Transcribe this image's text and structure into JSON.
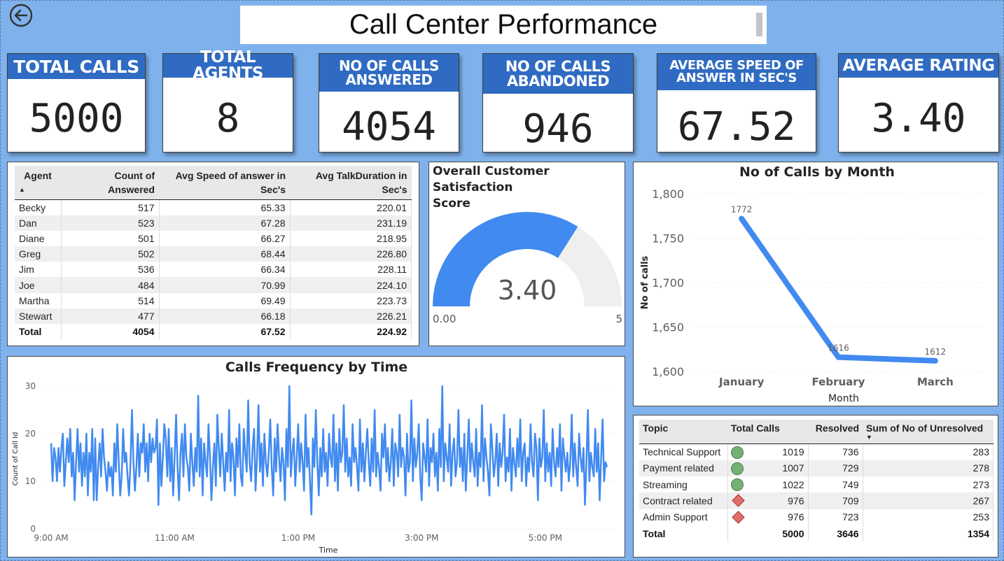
{
  "header": {
    "title": "Call Center Performance"
  },
  "kpis": {
    "total_calls": {
      "label": "TOTAL CALLS",
      "value": "5000"
    },
    "total_agents": {
      "label": "TOTAL AGENTS",
      "value": "8"
    },
    "answered": {
      "label_1": "NO OF CALLS",
      "label_2": "ANSWERED",
      "value": "4054"
    },
    "abandoned": {
      "label_1": "NO OF CALLS",
      "label_2": "ABANDONED",
      "value": "946"
    },
    "speed": {
      "label_1": "AVERAGE SPEED OF",
      "label_2": "ANSWER IN SEC'S",
      "value": "67.52"
    },
    "rating": {
      "label": "AVERAGE RATING",
      "value": "3.40"
    }
  },
  "agent_table": {
    "headers": {
      "agent": "Agent",
      "count_1": "Count of",
      "count_2": "Answered",
      "speed_1": "Avg Speed of answer in",
      "speed_2": "Sec's",
      "talk_1": "Avg TalkDuration in",
      "talk_2": "Sec's"
    },
    "rows": [
      {
        "agent": "Becky",
        "count": "517",
        "speed": "65.33",
        "talk": "220.01"
      },
      {
        "agent": "Dan",
        "count": "523",
        "speed": "67.28",
        "talk": "231.19"
      },
      {
        "agent": "Diane",
        "count": "501",
        "speed": "66.27",
        "talk": "218.95"
      },
      {
        "agent": "Greg",
        "count": "502",
        "speed": "68.44",
        "talk": "226.80"
      },
      {
        "agent": "Jim",
        "count": "536",
        "speed": "66.34",
        "talk": "228.11"
      },
      {
        "agent": "Joe",
        "count": "484",
        "speed": "70.99",
        "talk": "224.10"
      },
      {
        "agent": "Martha",
        "count": "514",
        "speed": "69.49",
        "talk": "223.73"
      },
      {
        "agent": "Stewart",
        "count": "477",
        "speed": "66.18",
        "talk": "226.21"
      }
    ],
    "total": {
      "label": "Total",
      "count": "4054",
      "speed": "67.52",
      "talk": "224.92"
    }
  },
  "gauge": {
    "title_1": "Overall Customer Satisfaction",
    "title_2": "Score",
    "value": 3.4,
    "value_label": "3.40",
    "min": 0,
    "max": 5,
    "min_label": "0.00",
    "max_label": "5",
    "fill_color": "#418af0",
    "track_color": "#efefef"
  },
  "chart_data": [
    {
      "type": "line",
      "title": "No of Calls by Month",
      "xlabel": "Month",
      "ylabel": "No of calls",
      "categories": [
        "January",
        "February",
        "March"
      ],
      "values": [
        1772,
        1616,
        1612
      ],
      "data_labels": [
        "1772",
        "1616",
        "1612"
      ],
      "ylim": [
        1600,
        1800
      ],
      "yticks": [
        1600,
        1650,
        1700,
        1750,
        1800
      ],
      "ytick_labels": [
        "1,600",
        "1,650",
        "1,700",
        "1,750",
        "1,800"
      ],
      "color": "#418af0",
      "grid": true
    },
    {
      "type": "line",
      "title": "Calls Frequency by Time",
      "xlabel": "Time",
      "ylabel": "Count of Call Id",
      "xticks": [
        "9:00 AM",
        "11:00 AM",
        "1:00 PM",
        "3:00 PM",
        "5:00 PM"
      ],
      "xrange_minutes": [
        540,
        1080
      ],
      "yticks": [
        0,
        10,
        20,
        30
      ],
      "ylim": [
        0,
        30
      ],
      "color": "#418af0",
      "grid": true,
      "values": [
        18,
        10,
        17,
        15,
        10,
        17,
        12,
        17,
        20,
        9,
        14,
        19,
        14,
        21,
        11,
        16,
        6,
        14,
        21,
        12,
        18,
        9,
        16,
        11,
        20,
        7,
        16,
        12,
        21,
        6,
        19,
        6,
        13,
        18,
        11,
        21,
        15,
        12,
        8,
        14,
        11,
        13,
        7,
        18,
        12,
        22,
        14,
        7,
        11,
        21,
        14,
        16,
        11,
        7,
        14,
        25,
        14,
        8,
        13,
        20,
        11,
        18,
        16,
        22,
        12,
        18,
        10,
        20,
        14,
        19,
        16,
        17,
        23,
        5,
        18,
        9,
        15,
        22,
        19,
        11,
        21,
        10,
        17,
        7,
        15,
        24,
        13,
        6,
        16,
        20,
        11,
        22,
        15,
        13,
        8,
        20,
        14,
        9,
        17,
        12,
        28,
        11,
        19,
        7,
        18,
        14,
        11,
        22,
        15,
        6,
        13,
        18,
        9,
        24,
        17,
        11,
        20,
        14,
        8,
        16,
        12,
        25,
        10,
        18,
        15,
        7,
        19,
        13,
        22,
        11,
        9,
        21,
        16,
        12,
        27,
        14,
        10,
        17,
        21,
        8,
        15,
        26,
        12,
        18,
        9,
        20,
        14,
        11,
        16,
        23,
        13,
        7,
        19,
        12,
        22,
        15,
        10,
        17,
        14,
        6,
        21,
        13,
        30,
        11,
        16,
        19,
        9,
        15,
        22,
        12,
        18,
        14,
        8,
        24,
        13,
        17,
        10,
        3,
        19,
        13,
        25,
        14,
        7,
        17,
        11,
        21,
        12,
        16,
        9,
        20,
        15,
        13,
        24,
        10,
        18,
        8,
        21,
        14,
        16,
        26,
        12,
        19,
        11,
        15,
        9,
        22,
        14,
        17,
        13,
        8,
        23,
        12,
        18,
        10,
        16,
        21,
        14,
        9,
        19,
        12,
        25,
        11,
        16,
        13,
        8,
        20,
        15,
        22,
        12,
        17,
        10,
        14,
        21,
        9,
        18,
        16,
        11,
        24,
        13,
        17,
        15,
        7,
        20,
        12,
        14,
        27,
        10,
        19,
        13,
        16,
        22,
        11,
        6,
        18,
        15,
        12,
        23,
        9,
        17,
        14,
        20,
        11,
        16,
        8,
        21,
        13,
        30,
        10,
        18,
        15,
        12,
        22,
        9,
        16,
        19,
        11,
        14,
        25,
        13,
        17,
        10,
        20,
        8,
        15,
        23,
        12,
        18,
        14,
        11,
        21,
        9,
        16,
        13,
        26,
        10,
        19,
        15,
        12,
        7,
        22,
        17,
        11,
        14,
        20,
        9,
        18,
        13,
        16,
        24,
        10,
        15,
        12,
        21,
        8,
        17,
        14,
        11,
        19,
        13,
        23,
        10,
        16,
        18,
        9,
        15,
        12,
        22,
        14,
        11,
        20,
        17,
        6,
        19,
        13,
        15,
        25,
        10,
        18,
        12,
        16,
        9,
        21,
        14,
        11,
        17,
        13,
        22,
        8,
        19,
        15,
        12,
        16,
        10,
        14,
        24,
        11,
        18,
        13,
        9,
        20,
        15,
        12,
        17,
        5,
        14,
        25,
        10,
        16,
        13,
        11,
        21,
        12,
        18,
        6,
        15,
        23,
        10,
        14,
        13
      ]
    }
  ],
  "topic_table": {
    "headers": {
      "topic": "Topic",
      "total": "Total Calls",
      "resolved": "Resolved",
      "unresolved": "Sum of No of Unresolved"
    },
    "rows": [
      {
        "topic": "Technical Support",
        "status": "green",
        "total": "1019",
        "resolved": "736",
        "unresolved": "283"
      },
      {
        "topic": "Payment related",
        "status": "green",
        "total": "1007",
        "resolved": "729",
        "unresolved": "278"
      },
      {
        "topic": "Streaming",
        "status": "green",
        "total": "1022",
        "resolved": "749",
        "unresolved": "273"
      },
      {
        "topic": "Contract related",
        "status": "red",
        "total": "976",
        "resolved": "709",
        "unresolved": "267"
      },
      {
        "topic": "Admin Support",
        "status": "red",
        "total": "976",
        "resolved": "723",
        "unresolved": "253"
      }
    ],
    "total": {
      "label": "Total",
      "total": "5000",
      "resolved": "3646",
      "unresolved": "1354"
    }
  },
  "icons": {
    "back": "back-arrow-icon",
    "green_status": "green-circle-icon",
    "red_status": "red-diamond-icon"
  },
  "colors": {
    "background": "#7fb2ec",
    "kpi_header": "#2f6bc2",
    "series": "#418af0"
  }
}
